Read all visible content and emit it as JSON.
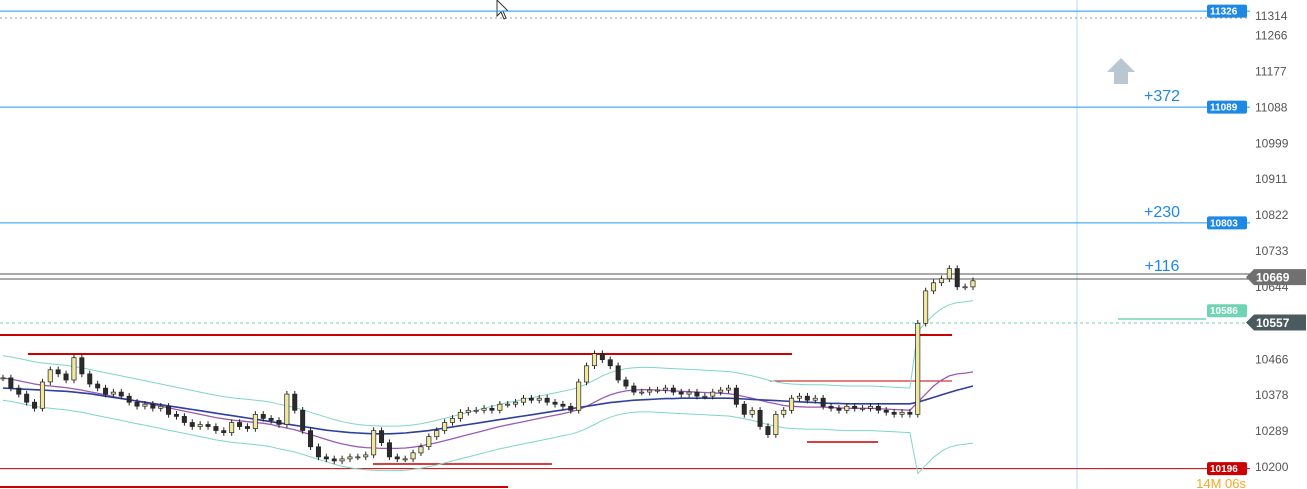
{
  "chart_data": {
    "type": "candlestick",
    "title": "",
    "xlabel": "",
    "ylabel": "",
    "ylim": [
      10190,
      11340
    ],
    "y_ticks": [
      11314,
      11266,
      11177,
      11088,
      10999,
      10911,
      10822,
      10733,
      10644,
      10466,
      10378,
      10289,
      10200
    ],
    "price_tags": [
      {
        "label": "11326",
        "value": 11326,
        "color": "#1e88e5",
        "style": "small"
      },
      {
        "label": "11089",
        "value": 11089,
        "color": "#1e88e5",
        "style": "small"
      },
      {
        "label": "10803",
        "value": 10803,
        "color": "#1e88e5",
        "style": "small"
      },
      {
        "label": "10669",
        "value": 10669,
        "color": "#707070",
        "style": "big"
      },
      {
        "label": "10586",
        "value": 10586,
        "color": "#6fd3b4",
        "style": "small"
      },
      {
        "label": "10557",
        "value": 10557,
        "color": "#4a5a5f",
        "style": "big"
      },
      {
        "label": "10196",
        "value": 10196,
        "color": "#cc0000",
        "style": "small"
      }
    ],
    "annotations": [
      {
        "text": "+372",
        "value": 11089
      },
      {
        "text": "+230",
        "value": 10803
      },
      {
        "text": "+116",
        "value": 10669
      }
    ],
    "horizontal_lines": [
      {
        "value": 11326,
        "color": "#2196f3"
      },
      {
        "value": 11089,
        "color": "#2196f3"
      },
      {
        "value": 10803,
        "color": "#2196f3"
      },
      {
        "value": 10196,
        "color": "#cc0000"
      }
    ],
    "price_series": [
      10420,
      10395,
      10380,
      10360,
      10345,
      10410,
      10440,
      10430,
      10415,
      10470,
      10430,
      10405,
      10395,
      10380,
      10385,
      10375,
      10360,
      10350,
      10355,
      10345,
      10350,
      10330,
      10325,
      10310,
      10300,
      10305,
      10300,
      10290,
      10285,
      10310,
      10300,
      10295,
      10330,
      10320,
      10315,
      10305,
      10380,
      10340,
      10290,
      10250,
      10225,
      10220,
      10215,
      10220,
      10225,
      10225,
      10230,
      10290,
      10260,
      10225,
      10220,
      10220,
      10235,
      10250,
      10275,
      10290,
      10310,
      10320,
      10335,
      10340,
      10340,
      10345,
      10340,
      10355,
      10355,
      10360,
      10370,
      10365,
      10370,
      10360,
      10355,
      10350,
      10340,
      10410,
      10450,
      10480,
      10465,
      10450,
      10415,
      10400,
      10385,
      10385,
      10390,
      10390,
      10395,
      10385,
      10380,
      10385,
      10375,
      10375,
      10385,
      10390,
      10395,
      10355,
      10330,
      10340,
      10300,
      10280,
      10330,
      10340,
      10370,
      10375,
      10365,
      10370,
      10350,
      10345,
      10340,
      10350,
      10345,
      10345,
      10350,
      10340,
      10335,
      10330,
      10335,
      10330,
      10555,
      10635,
      10655,
      10665,
      10690,
      10645,
      10645,
      10660
    ],
    "ma_fast": [
      10420,
      10417,
      10413,
      10409,
      10405,
      10402,
      10400,
      10398,
      10396,
      10393,
      10390,
      10386,
      10382,
      10378,
      10374,
      10370,
      10366,
      10362,
      10358,
      10354,
      10350,
      10346,
      10342,
      10338,
      10334,
      10330,
      10326,
      10322,
      10319,
      10316,
      10314,
      10312,
      10310,
      10308,
      10305,
      10300,
      10296,
      10292,
      10286,
      10280,
      10274,
      10268,
      10262,
      10257,
      10253,
      10250,
      10248,
      10247,
      10246,
      10246,
      10246,
      10247,
      10249,
      10252,
      10256,
      10260,
      10265,
      10270,
      10275,
      10280,
      10285,
      10290,
      10295,
      10300,
      10304,
      10308,
      10312,
      10316,
      10320,
      10324,
      10328,
      10332,
      10336,
      10342,
      10350,
      10360,
      10370,
      10378,
      10384,
      10388,
      10390,
      10391,
      10391,
      10390,
      10389,
      10388,
      10387,
      10386,
      10385,
      10384,
      10383,
      10382,
      10381,
      10378,
      10374,
      10370,
      10365,
      10360,
      10356,
      10352,
      10350,
      10349,
      10348,
      10348,
      10348,
      10347,
      10346,
      10345,
      10345,
      10345,
      10345,
      10344,
      10343,
      10342,
      10341,
      10340,
      10360,
      10380,
      10400,
      10415,
      10425,
      10430,
      10432,
      10435
    ],
    "ma_slow": [
      10395,
      10394,
      10393,
      10392,
      10391,
      10390,
      10389,
      10388,
      10387,
      10385,
      10383,
      10381,
      10378,
      10375,
      10372,
      10369,
      10366,
      10363,
      10360,
      10357,
      10354,
      10351,
      10348,
      10345,
      10342,
      10339,
      10336,
      10333,
      10330,
      10327,
      10324,
      10321,
      10318,
      10315,
      10312,
      10309,
      10306,
      10303,
      10300,
      10297,
      10294,
      10291,
      10289,
      10287,
      10285,
      10284,
      10283,
      10282,
      10282,
      10282,
      10283,
      10284,
      10286,
      10288,
      10290,
      10293,
      10296,
      10299,
      10302,
      10305,
      10308,
      10311,
      10314,
      10317,
      10320,
      10323,
      10326,
      10329,
      10332,
      10335,
      10338,
      10341,
      10344,
      10347,
      10350,
      10353,
      10356,
      10359,
      10361,
      10363,
      10365,
      10366,
      10367,
      10368,
      10369,
      10369,
      10370,
      10370,
      10370,
      10370,
      10370,
      10370,
      10370,
      10369,
      10368,
      10367,
      10366,
      10365,
      10364,
      10363,
      10362,
      10361,
      10360,
      10359,
      10358,
      10357,
      10357,
      10356,
      10356,
      10356,
      10356,
      10356,
      10356,
      10356,
      10356,
      10356,
      10360,
      10366,
      10372,
      10378,
      10384,
      10390,
      10395,
      10400
    ],
    "countdown": "14M 06s"
  }
}
